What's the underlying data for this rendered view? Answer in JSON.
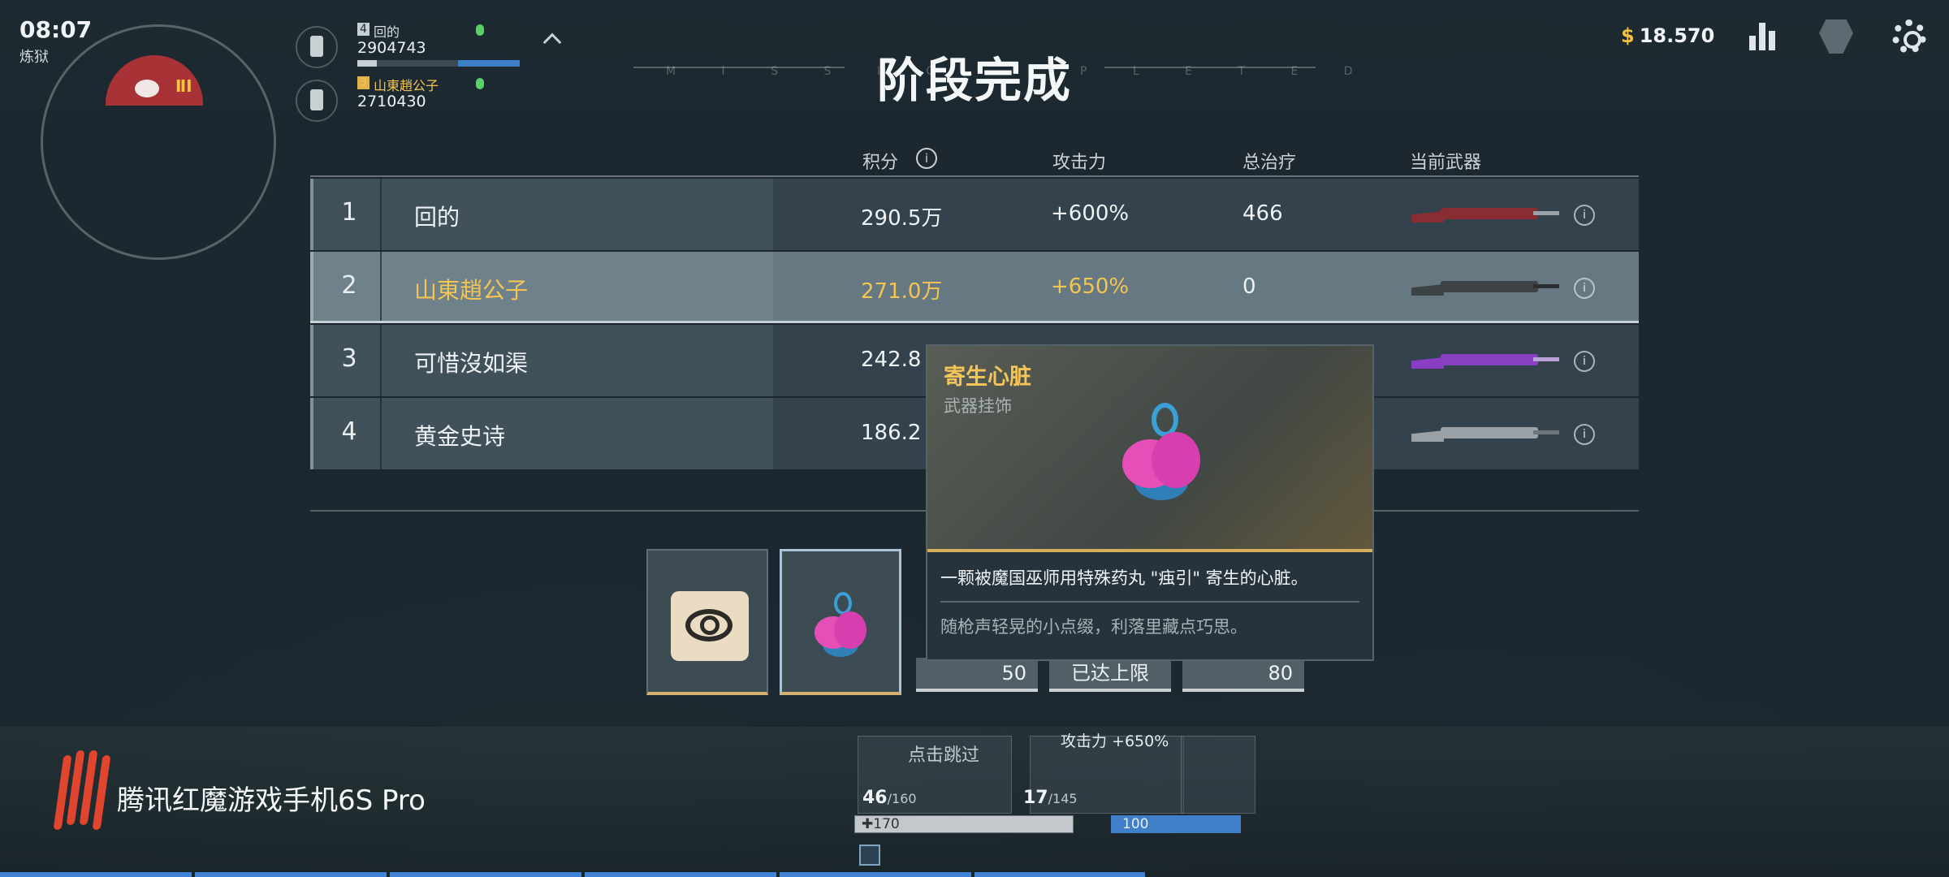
{
  "hud": {
    "time": "08:07",
    "map_name": "炼狱",
    "money": "18.570",
    "squad": [
      {
        "num": "4",
        "name": "回的",
        "score": "2904743"
      },
      {
        "num": "3",
        "name": "山東趙公子",
        "score": "2710430"
      }
    ]
  },
  "title": "阶段完成",
  "title_deco": {
    "left": "M I S S I O",
    "right": "P L E T E D"
  },
  "table": {
    "headers": {
      "score": "积分",
      "attack": "攻击力",
      "healing": "总治疗",
      "weapon": "当前武器"
    },
    "rows": [
      {
        "rank": "1",
        "name": "回的",
        "score": "290.5万",
        "attack": "+600%",
        "healing": "466",
        "weapon_color": "red"
      },
      {
        "rank": "2",
        "name": "山東趙公子",
        "score": "271.0万",
        "attack": "+650%",
        "healing": "0",
        "weapon_color": "dark"
      },
      {
        "rank": "3",
        "name": "可惜沒如渠",
        "score": "242.8",
        "attack": "",
        "healing": "",
        "weapon_color": "purple"
      },
      {
        "rank": "4",
        "name": "黄金史诗",
        "score": "186.2",
        "attack": "",
        "healing": "",
        "weapon_color": "gray"
      }
    ]
  },
  "rewards": [
    {
      "icon": "eye-card-icon",
      "value": ""
    },
    {
      "icon": "parasite-heart-icon",
      "value": ""
    },
    {
      "value": "50"
    },
    {
      "value": "已达上限"
    },
    {
      "value": "80"
    }
  ],
  "tooltip": {
    "title": "寄生心脏",
    "type": "武器挂饰",
    "description": "一颗被魔国巫师用特殊药丸 \"痋引\" 寄生的心脏。",
    "flavor": "随枪声轻晃的小点缀，利落里藏点巧思。"
  },
  "bottom_hud": {
    "brand": "腾讯红魔游戏手机6S Pro",
    "skip_label": "点击跳过",
    "primary_ammo": "46",
    "primary_reserve": "/160",
    "secondary_ammo": "17",
    "secondary_reserve": "/145",
    "attack_buff": "攻击力 +650%",
    "hp": "170",
    "armor": "100"
  },
  "colors": {
    "gold": "#f3c553",
    "accent_blue": "#3f82d6",
    "brand_red": "#e0452d"
  }
}
